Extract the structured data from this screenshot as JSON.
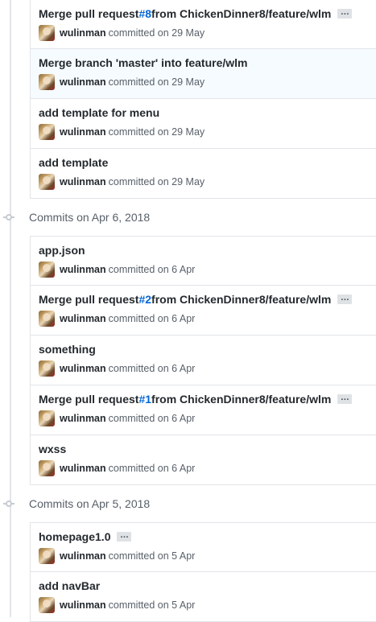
{
  "groups": [
    {
      "header": "",
      "commits": [
        {
          "pre": "Merge pull request ",
          "issue": "#8",
          "post": " from ChickenDinner8/feature/wlm",
          "author": "wulinman",
          "date": "committed on 29 May",
          "ellipsis": "…"
        },
        {
          "pre": "Merge branch 'master' into feature/wlm",
          "issue": "",
          "post": "",
          "author": "wulinman",
          "date": "committed on 29 May"
        },
        {
          "pre": "add template for menu",
          "issue": "",
          "post": "",
          "author": "wulinman",
          "date": "committed on 29 May"
        },
        {
          "pre": "add template",
          "issue": "",
          "post": "",
          "author": "wulinman",
          "date": "committed on 29 May"
        }
      ]
    },
    {
      "header": "Commits on Apr 6, 2018",
      "commits": [
        {
          "pre": "app.json",
          "issue": "",
          "post": "",
          "author": "wulinman",
          "date": "committed on 6 Apr"
        },
        {
          "pre": "Merge pull request ",
          "issue": "#2",
          "post": " from ChickenDinner8/feature/wlm",
          "author": "wulinman",
          "date": "committed on 6 Apr",
          "ellipsis": "…"
        },
        {
          "pre": "something",
          "issue": "",
          "post": "",
          "author": "wulinman",
          "date": "committed on 6 Apr"
        },
        {
          "pre": "Merge pull request ",
          "issue": "#1",
          "post": " from ChickenDinner8/feature/wlm",
          "author": "wulinman",
          "date": "committed on 6 Apr",
          "ellipsis": "…"
        },
        {
          "pre": "wxss",
          "issue": "",
          "post": "",
          "author": "wulinman",
          "date": "committed on 6 Apr"
        }
      ]
    },
    {
      "header": "Commits on Apr 5, 2018",
      "commits": [
        {
          "pre": "homepage1.0",
          "issue": "",
          "post": "",
          "author": "wulinman",
          "date": "committed on 5 Apr",
          "ellipsis": "…"
        },
        {
          "pre": "add navBar",
          "issue": "",
          "post": "",
          "author": "wulinman",
          "date": "committed on 5 Apr"
        }
      ]
    }
  ]
}
